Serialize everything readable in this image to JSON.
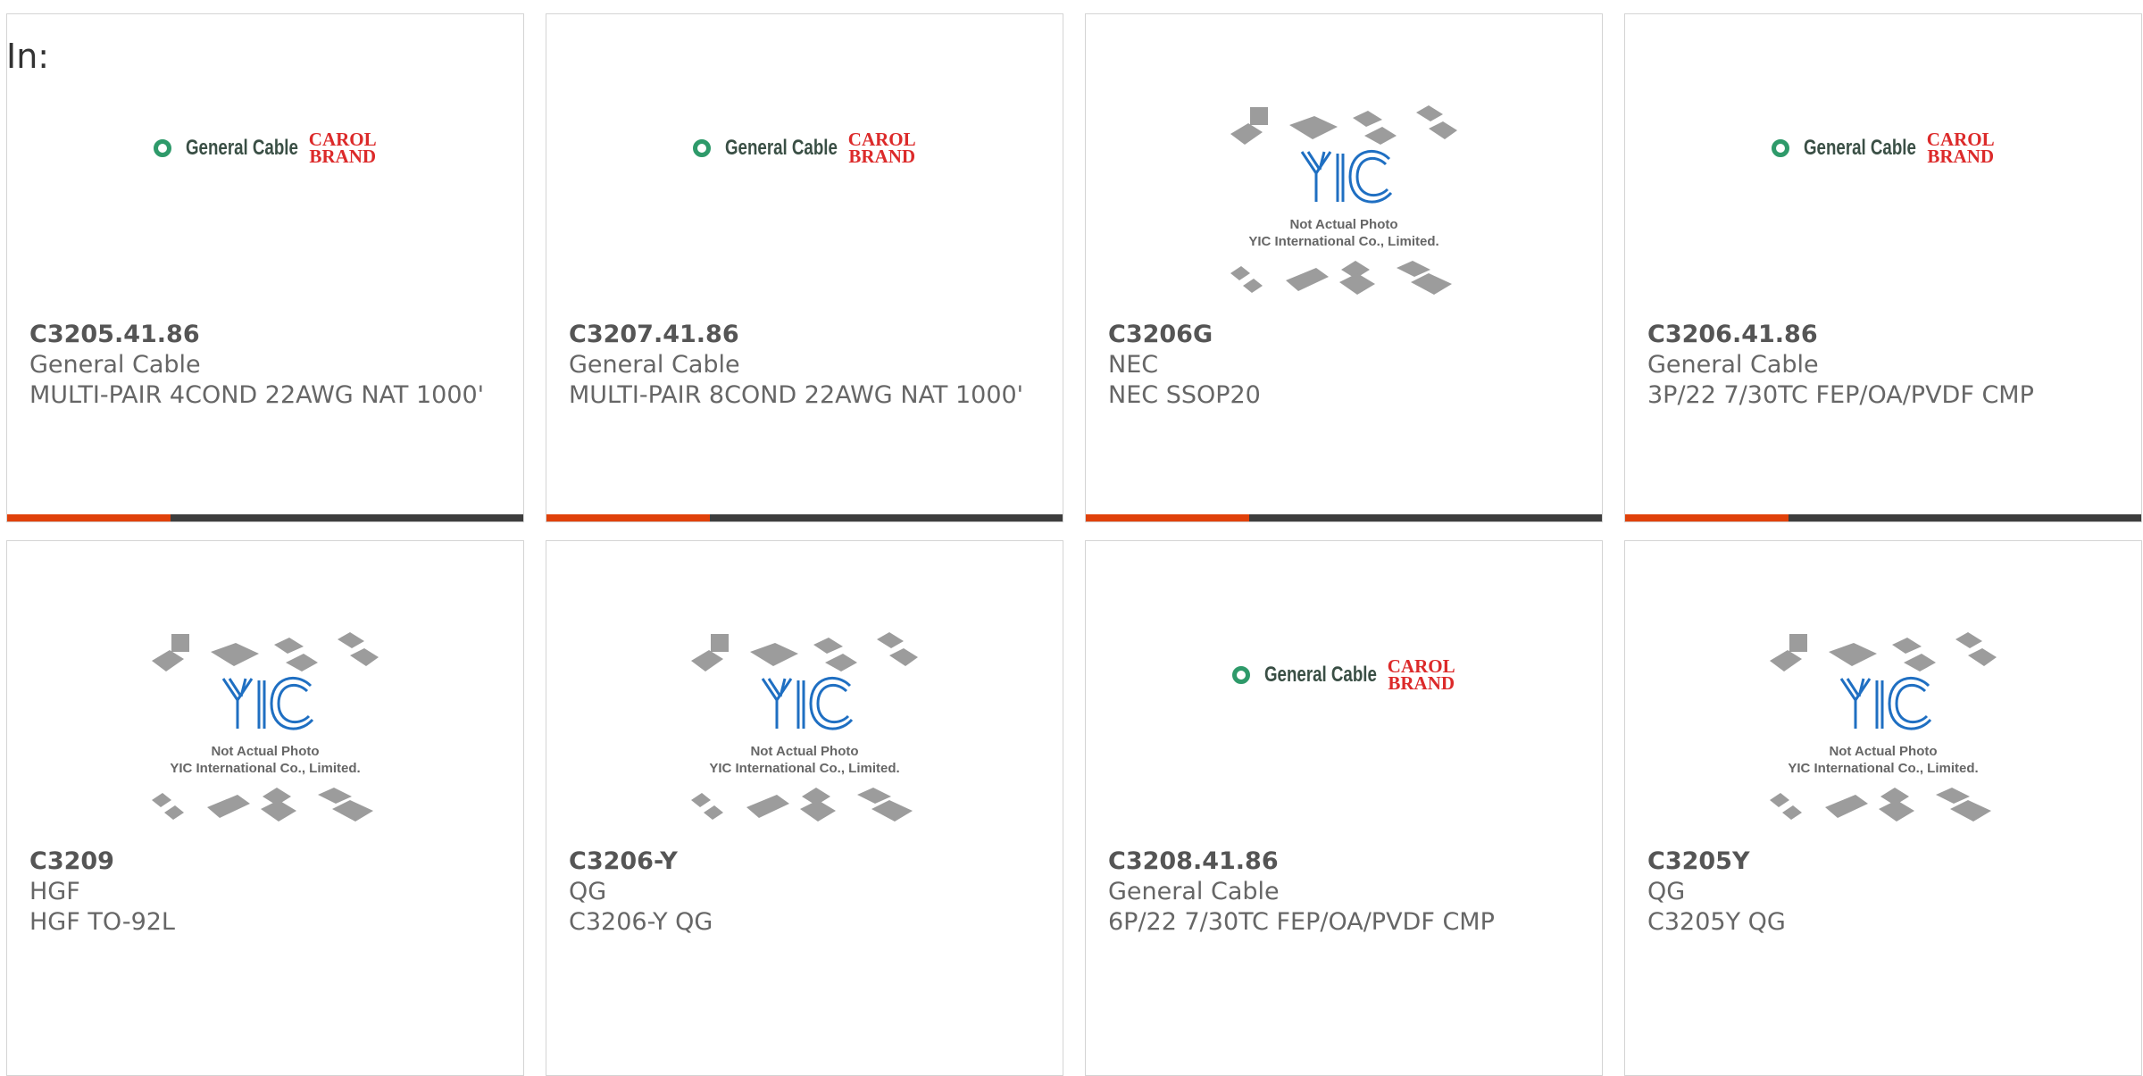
{
  "page": {
    "in_label": "In:"
  },
  "brand_logos": {
    "general_cable": {
      "text": "General Cable",
      "carol_line1": "CAROL",
      "carol_line2": "BRAND"
    },
    "yic_placeholder": {
      "line1": "Not Actual Photo",
      "line2": "YIC International Co., Limited."
    }
  },
  "colors": {
    "accent": "#e0410a",
    "bar_dark": "#3d3d3d",
    "yic_blue": "#1f6fc2",
    "gc_green": "#2e9a6a",
    "carol_red": "#dc2a2a"
  },
  "products": [
    {
      "part": "C3205.41.86",
      "manufacturer": "General Cable",
      "description": "MULTI-PAIR 4COND 22AWG NAT 1000'",
      "image": "general-cable-logo"
    },
    {
      "part": "C3207.41.86",
      "manufacturer": "General Cable",
      "description": "MULTI-PAIR 8COND 22AWG NAT 1000'",
      "image": "general-cable-logo"
    },
    {
      "part": "C3206G",
      "manufacturer": "NEC",
      "description": "NEC SSOP20",
      "image": "yic-not-actual-photo"
    },
    {
      "part": "C3206.41.86",
      "manufacturer": "General Cable",
      "description": "3P/22 7/30TC FEP/OA/PVDF CMP",
      "image": "general-cable-logo"
    },
    {
      "part": "C3209",
      "manufacturer": "HGF",
      "description": "HGF TO-92L",
      "image": "yic-not-actual-photo"
    },
    {
      "part": "C3206-Y",
      "manufacturer": "QG",
      "description": "C3206-Y QG",
      "image": "yic-not-actual-photo"
    },
    {
      "part": "C3208.41.86",
      "manufacturer": "General Cable",
      "description": "6P/22 7/30TC FEP/OA/PVDF CMP",
      "image": "general-cable-logo"
    },
    {
      "part": "C3205Y",
      "manufacturer": "QG",
      "description": "C3205Y QG",
      "image": "yic-not-actual-photo"
    }
  ]
}
